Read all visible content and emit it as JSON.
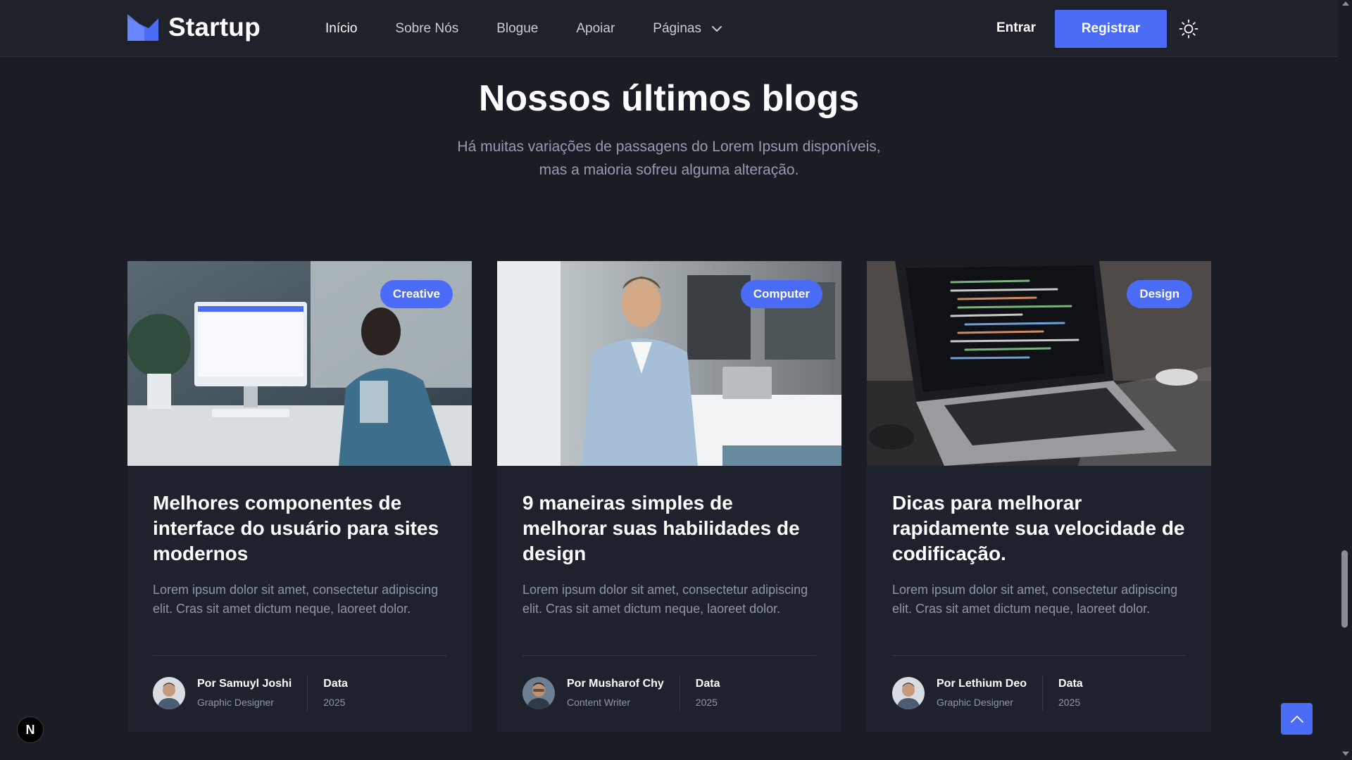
{
  "header": {
    "brand": "Startup",
    "nav": [
      {
        "label": "Início",
        "active": true
      },
      {
        "label": "Sobre Nós",
        "active": false
      },
      {
        "label": "Blogue",
        "active": false
      },
      {
        "label": "Apoiar",
        "active": false
      },
      {
        "label": "Páginas",
        "active": false,
        "dropdown": true
      }
    ],
    "login_label": "Entrar",
    "register_label": "Registrar",
    "theme_icon": "sun-icon"
  },
  "section": {
    "title": "Nossos últimos blogs",
    "subtitle_line1": "Há muitas variações de passagens do Lorem Ipsum disponíveis,",
    "subtitle_line2": "mas a maioria sofreu alguma alteração."
  },
  "posts": [
    {
      "tag": "Creative",
      "title": "Melhores componentes de interface do usuário para sites modernos",
      "excerpt": "Lorem ipsum dolor sit amet, consectetur adipiscing elit. Cras sit amet dictum neque, laoreet dolor.",
      "author": "Por Samuyl Joshi",
      "role": "Graphic Designer",
      "date_label": "Data",
      "date": "2025"
    },
    {
      "tag": "Computer",
      "title": "9 maneiras simples de melhorar suas habilidades de design",
      "excerpt": "Lorem ipsum dolor sit amet, consectetur adipiscing elit. Cras sit amet dictum neque, laoreet dolor.",
      "author": "Por Musharof Chy",
      "role": "Content Writer",
      "date_label": "Data",
      "date": "2025"
    },
    {
      "tag": "Design",
      "title": "Dicas para melhorar rapidamente sua velocidade de codificação.",
      "excerpt": "Lorem ipsum dolor sit amet, consectetur adipiscing elit. Cras sit amet dictum neque, laoreet dolor.",
      "author": "Por Lethium Deo",
      "role": "Graphic Designer",
      "date_label": "Data",
      "date": "2025"
    }
  ],
  "floating": {
    "next_badge": "N",
    "back_to_top_icon": "chevron-up-icon"
  },
  "colors": {
    "background": "#1b1d25",
    "card": "#1e222c",
    "accent": "#4a6cf7",
    "muted_text": "#8f96aa"
  }
}
